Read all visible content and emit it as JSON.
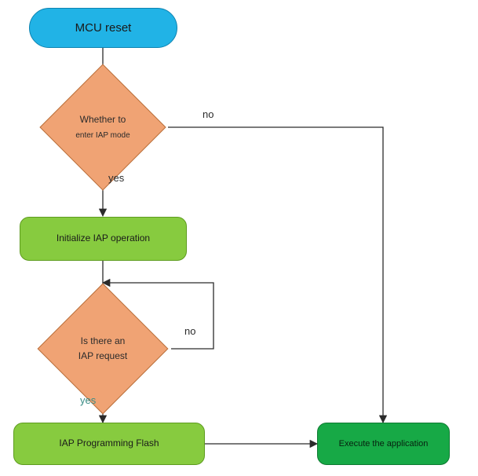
{
  "nodes": {
    "start": {
      "label": "MCU reset"
    },
    "d1": {
      "line1": "Whether to",
      "line2": "enter IAP mode"
    },
    "p1": {
      "label": "Initialize IAP operation"
    },
    "d2": {
      "line1": "Is there an",
      "line2": "IAP request"
    },
    "p2": {
      "label": "IAP Programming Flash"
    },
    "p3": {
      "label": "Execute the application"
    }
  },
  "edges": {
    "d1_no": "no",
    "d1_yes": "yes",
    "d2_no": "no",
    "d2_yes": "yes"
  },
  "chart_data": {
    "type": "flowchart",
    "nodes": [
      {
        "id": "start",
        "kind": "terminator",
        "text": "MCU reset"
      },
      {
        "id": "d1",
        "kind": "decision",
        "text": "Whether to enter IAP mode"
      },
      {
        "id": "p1",
        "kind": "process",
        "text": "Initialize IAP operation"
      },
      {
        "id": "d2",
        "kind": "decision",
        "text": "Is there an IAP request"
      },
      {
        "id": "p2",
        "kind": "process",
        "text": "IAP Programming Flash"
      },
      {
        "id": "p3",
        "kind": "process",
        "text": "Execute the application"
      }
    ],
    "edges": [
      {
        "from": "start",
        "to": "d1"
      },
      {
        "from": "d1",
        "to": "p1",
        "label": "yes"
      },
      {
        "from": "d1",
        "to": "p3",
        "label": "no"
      },
      {
        "from": "p1",
        "to": "d2"
      },
      {
        "from": "d2",
        "to": "p2",
        "label": "yes"
      },
      {
        "from": "d2",
        "to": "d2",
        "label": "no",
        "loop": true
      },
      {
        "from": "p2",
        "to": "p3"
      }
    ]
  }
}
